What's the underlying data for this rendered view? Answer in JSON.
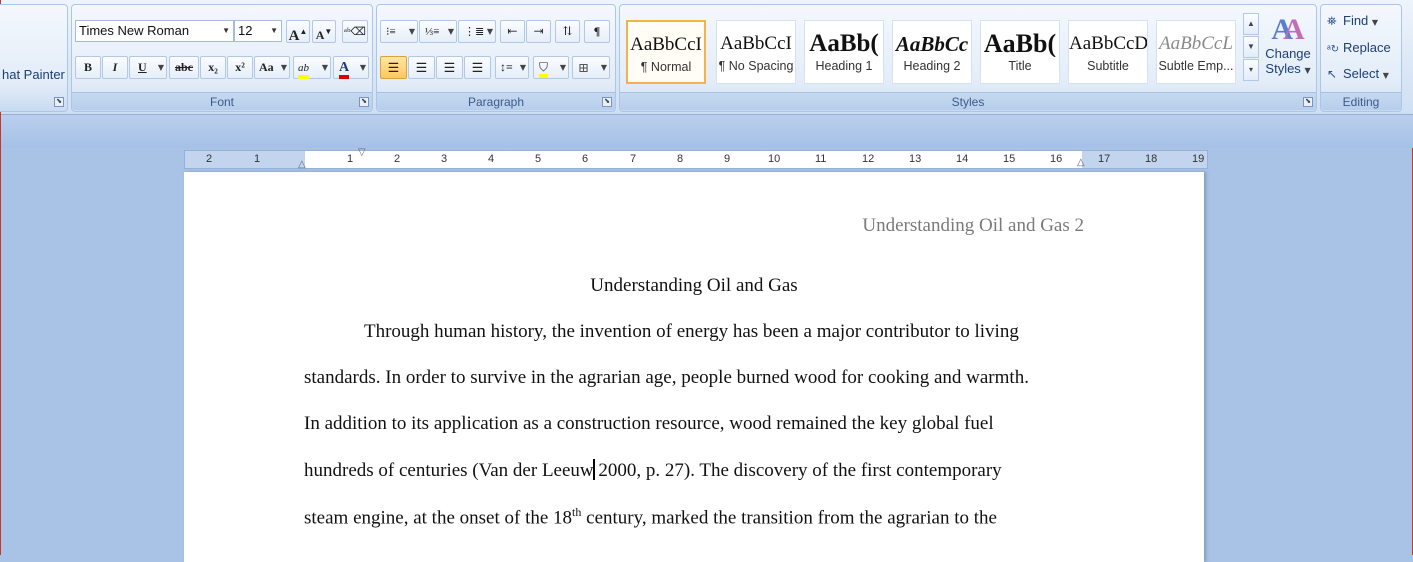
{
  "clipboard": {
    "format_painter_label": "hat Painter"
  },
  "font": {
    "group_label": "Font",
    "font_name": "Times New Roman",
    "font_size": "12",
    "grow_label": "A",
    "shrink_label": "A",
    "bold": "B",
    "italic": "I",
    "underline": "U",
    "strikethrough": "abc",
    "subscript": "x₂",
    "superscript": "x²",
    "change_case": "Aa",
    "highlight": "ab",
    "font_color": "A",
    "highlight_color": "#ffff00",
    "font_color_value": "#e00000"
  },
  "paragraph": {
    "group_label": "Paragraph",
    "show_marks": "¶"
  },
  "styles": {
    "group_label": "Styles",
    "items": [
      {
        "sample": "AaBbCcI",
        "name": "¶ Normal"
      },
      {
        "sample": "AaBbCcI",
        "name": "¶ No Spacing"
      },
      {
        "sample": "AaBb(",
        "name": "Heading 1"
      },
      {
        "sample": "AaBbCc",
        "name": "Heading 2"
      },
      {
        "sample": "AaBb(",
        "name": "Title"
      },
      {
        "sample": "AaBbCcD",
        "name": "Subtitle"
      },
      {
        "sample": "AaBbCcL",
        "name": "Subtle Emp..."
      }
    ],
    "change_styles_line1": "Change",
    "change_styles_line2": "Styles"
  },
  "editing": {
    "group_label": "Editing",
    "find": "Find",
    "replace": "Replace",
    "select": "Select"
  },
  "ruler": {
    "left_numbers": [
      "2",
      "1"
    ],
    "right_numbers": [
      "1",
      "2",
      "3",
      "4",
      "5",
      "6",
      "7",
      "8",
      "9",
      "10",
      "11",
      "12",
      "13",
      "14",
      "15",
      "16",
      "17",
      "18",
      "19"
    ]
  },
  "document": {
    "running_head": "Understanding Oil and Gas 2",
    "title": "Understanding Oil and Gas",
    "lines": [
      "Through human history, the invention of energy has been a major contributor to living",
      "standards. In order to survive in the agrarian age, people burned wood for cooking and warmth.",
      "In addition to its application as a construction resource, wood remained the key global fuel"
    ],
    "line4_before_caret": "hundreds of centuries (Van der Leeuw",
    "line4_after_caret": " 2000, p. 27). The discovery of the first contemporary",
    "line5_before_sup": "steam engine, at the onset of the 18",
    "line5_sup": "th",
    "line5_after_sup": " century, marked the transition from the agrarian to the"
  }
}
